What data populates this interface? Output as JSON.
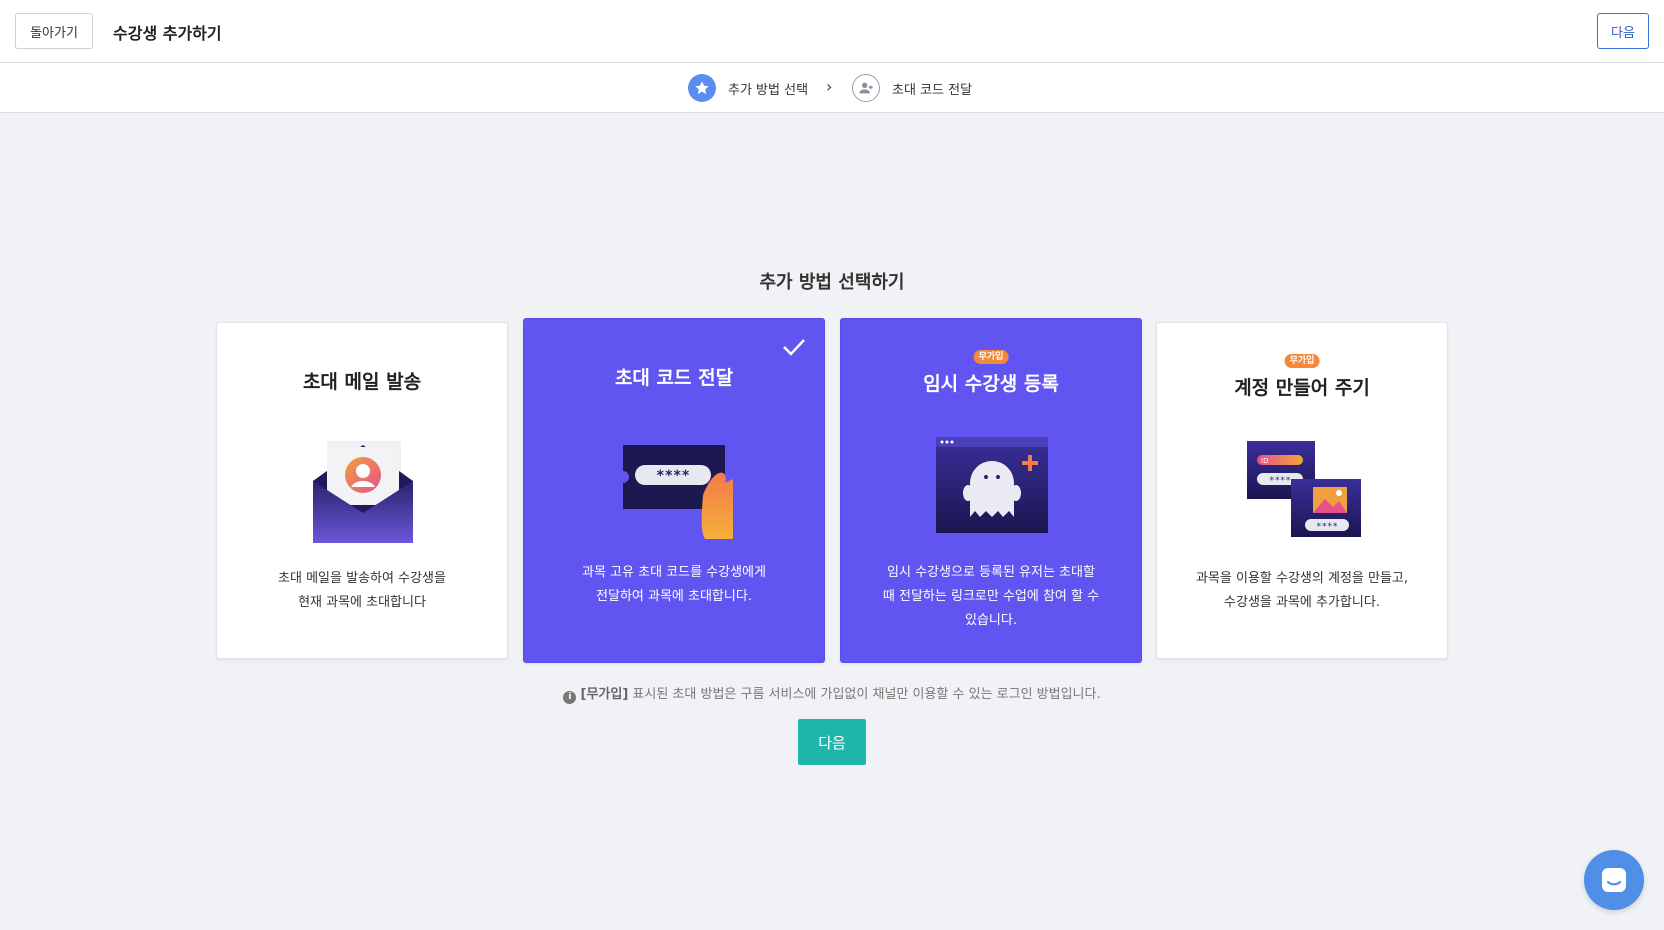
{
  "header": {
    "back_label": "돌아가기",
    "title": "수강생 추가하기",
    "next_label": "다음"
  },
  "steps": [
    {
      "label": "추가 방법 선택",
      "icon": "star-icon",
      "active": true
    },
    {
      "label": "초대 코드 전달",
      "icon": "add-user-icon",
      "active": false
    }
  ],
  "step_separator": "›",
  "section_title": "추가 방법 선택하기",
  "cards": [
    {
      "title": "초대 메일 발송",
      "badge": "",
      "desc_line1": "초대 메일을 발송하여 수강생을",
      "desc_line2": "현재 과목에 초대합니다",
      "desc_line3": "",
      "illustration": "envelope-icon",
      "selected": false
    },
    {
      "title": "초대 코드 전달",
      "badge": "",
      "desc_line1": "과목 고유 초대 코드를 수강생에게",
      "desc_line2": "전달하여 과목에 초대합니다.",
      "desc_line3": "",
      "illustration": "code-ticket-icon",
      "selected": true
    },
    {
      "title": "임시 수강생 등록",
      "badge": "무가입",
      "desc_line1": "임시 수강생으로 등록된 유저는 초대할",
      "desc_line2": "때 전달하는 링크로만 수업에 참여 할 수",
      "desc_line3": "있습니다.",
      "illustration": "ghost-icon",
      "selected": false
    },
    {
      "title": "계정 만들어 주기",
      "badge": "무가입",
      "desc_line1": "과목을 이용할 수강생의 계정을 만들고,",
      "desc_line2": "수강생을 과목에 추가합니다.",
      "desc_line3": "",
      "illustration": "account-form-icon",
      "selected": false
    }
  ],
  "illustration_text": {
    "stars": "****",
    "id_label": "ID"
  },
  "note": {
    "tag": "[무가입]",
    "text": " 표시된 초대 방법은 구름 서비스에 가입없이 채널만 이용할 수 있는 로그인 방법입니다."
  },
  "next_button_label": "다음",
  "colors": {
    "selected_card": "#6055f0",
    "accent_teal": "#1fb5ad",
    "badge_orange": "#f38a3b",
    "primary_blue": "#2a5fc8",
    "chat_blue": "#4f8fe8"
  }
}
